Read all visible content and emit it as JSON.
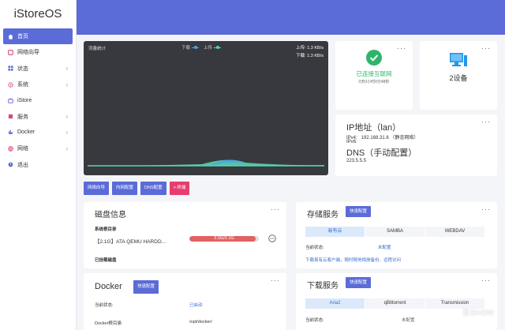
{
  "app": {
    "logo": "iStoreOS"
  },
  "sidebar": {
    "items": [
      {
        "label": "首页",
        "icon": "home-icon",
        "active": true,
        "arrow": false
      },
      {
        "label": "网络向导",
        "icon": "globe-icon",
        "active": false,
        "arrow": false
      },
      {
        "label": "状态",
        "icon": "grid-icon",
        "active": false,
        "arrow": true
      },
      {
        "label": "系统",
        "icon": "gear-icon",
        "active": false,
        "arrow": true
      },
      {
        "label": "iStore",
        "icon": "store-icon",
        "active": false,
        "arrow": false
      },
      {
        "label": "服务",
        "icon": "puzzle-icon",
        "active": false,
        "arrow": true
      },
      {
        "label": "Docker",
        "icon": "docker-icon",
        "active": false,
        "arrow": true
      },
      {
        "label": "网络",
        "icon": "network-icon",
        "active": false,
        "arrow": true
      },
      {
        "label": "退出",
        "icon": "logout-icon",
        "active": false,
        "arrow": false
      }
    ],
    "arrow_glyph": "›"
  },
  "traffic": {
    "title": "流量统计",
    "legend_down": "下载",
    "legend_up": "上传",
    "upload_rate": "上传: 1.3 KB/s",
    "download_rate": "下载: 1.3 KB/s",
    "colors": {
      "down": "#4aa3f0",
      "up": "#4fd9a8"
    }
  },
  "actions": [
    {
      "label": "网络向导",
      "style": "primary"
    },
    {
      "label": "内网配置",
      "style": "primary"
    },
    {
      "label": "DNS配置",
      "style": "primary"
    },
    {
      "label": "> 终端",
      "style": "danger"
    }
  ],
  "status": {
    "text": "已连接互联网",
    "sub": "0天0小时0分48秒",
    "menu": "···"
  },
  "devices": {
    "count": "2设备",
    "menu": "···"
  },
  "ip": {
    "title": "IP地址（lan）",
    "ipv4_label": "IPv4:",
    "ipv4_value": "192.168.31.6 （静态网络）",
    "ipv6_label": "IPv6:",
    "dns_title": "DNS（手动配置）",
    "dns_value": "223.5.5.5",
    "menu": "···"
  },
  "disk": {
    "title": "磁盘信息",
    "menu": "···",
    "root_label": "系统根目录",
    "disk_name": "【2.1G】ATA QEMU HARDD...",
    "usage_text": "2.0G/2.1G",
    "usage_fraction": 0.95,
    "mounted_label": "已挂载磁盘"
  },
  "storage": {
    "title": "存储服务",
    "quick": "快速配置",
    "menu": "···",
    "tabs": [
      "易有云",
      "SAMBA",
      "WEBDAV"
    ],
    "state_label": "当前状态:",
    "state_value": "未配置",
    "hint": "下载易有云客户端，随时随地相册备份、远程访问"
  },
  "docker": {
    "title": "Docker",
    "quick": "快速配置",
    "menu": "···",
    "state_label": "当前状态:",
    "state_value": "已启动",
    "root_label": "Docker根目录:",
    "root_value": "/opt/docker/"
  },
  "download": {
    "title": "下载服务",
    "quick": "快速配置",
    "menu": "···",
    "tabs": [
      "Aria2",
      "qBittorrent",
      "Transmission"
    ],
    "state_label": "当前状态:",
    "state_value": "未配置"
  },
  "watermark": "百分HOW",
  "colors": {
    "accent": "#5b6bd8",
    "danger": "#e83d6e",
    "success": "#2fb56a",
    "link": "#3a6fcf"
  }
}
